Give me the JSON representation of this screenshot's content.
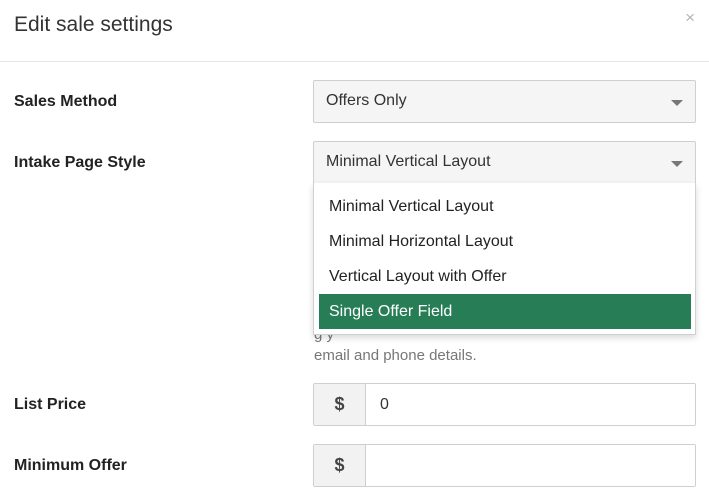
{
  "modal": {
    "title": "Edit sale settings",
    "close_glyph": "×"
  },
  "fields": {
    "sales_method": {
      "label": "Sales Method",
      "value": "Offers Only"
    },
    "intake_page_style": {
      "label": "Intake Page Style",
      "value": "Minimal Vertical Layout",
      "options": [
        "Minimal Vertical Layout",
        "Minimal Horizontal Layout",
        "Vertical Layout with Offer",
        "Single Offer Field"
      ],
      "highlighted_option": "Single Offer Field",
      "help_text": "email and phone details.",
      "help_text_partial": "g                              y"
    },
    "list_price": {
      "label": "List Price",
      "currency_symbol": "$",
      "value": "0"
    },
    "minimum_offer": {
      "label": "Minimum Offer",
      "currency_symbol": "$",
      "value": ""
    }
  },
  "colors": {
    "highlight": "#277d55",
    "select_bg": "#f5f5f5",
    "border": "#cfcfcf"
  },
  "icons": {
    "close": "close-icon",
    "dropdown": "chevron-down-icon"
  }
}
